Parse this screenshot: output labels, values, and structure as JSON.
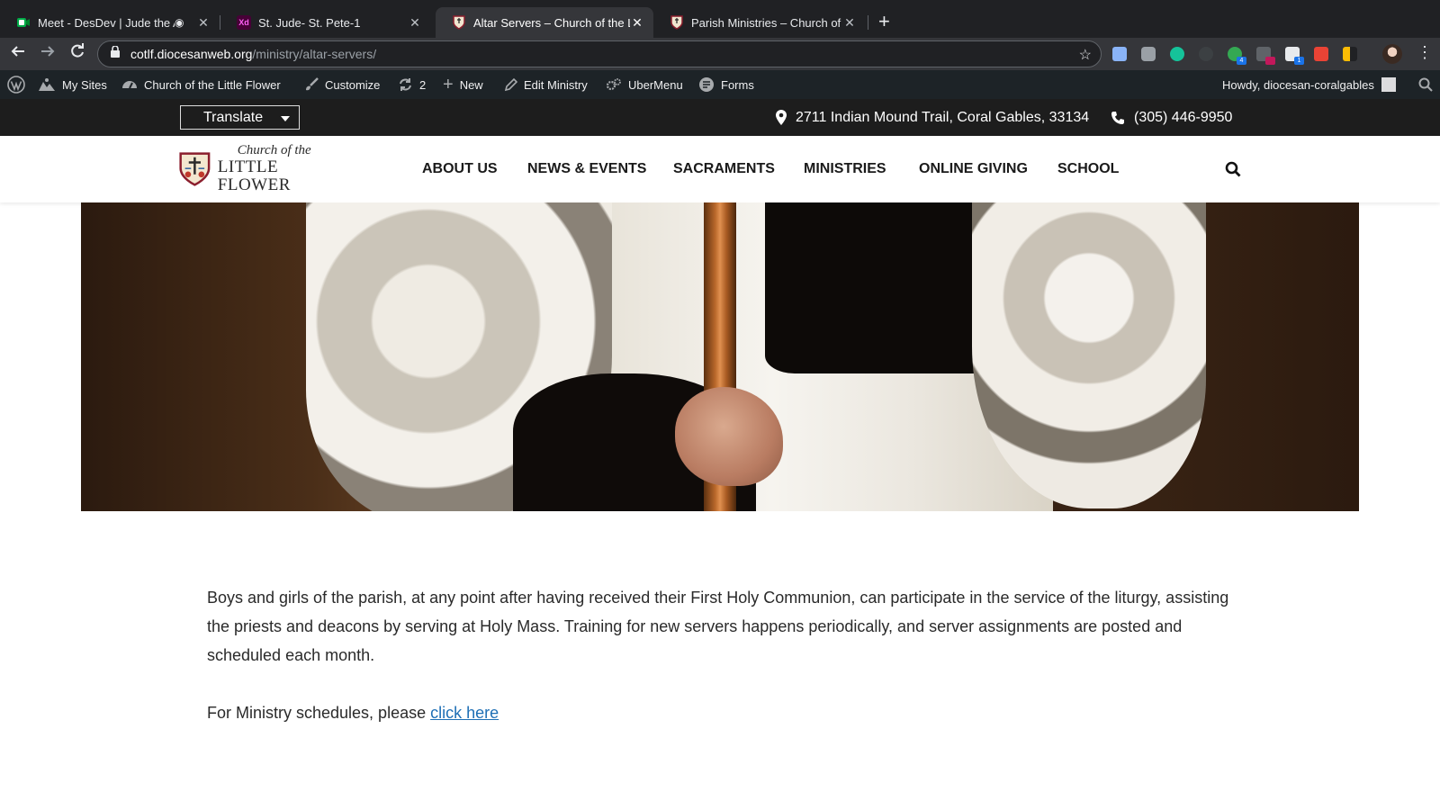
{
  "browser": {
    "tabs": [
      {
        "title": "Meet - DesDev | Jude the A",
        "active": false
      },
      {
        "title": "St. Jude- St. Pete-1",
        "active": false,
        "favicon_text": "Xd"
      },
      {
        "title": "Altar Servers – Church of the L",
        "active": true
      },
      {
        "title": "Parish Ministries – Church of th",
        "active": false
      }
    ],
    "url_domain": "cotlf.diocesanweb.org",
    "url_path": "/ministry/altar-servers/"
  },
  "admin_bar": {
    "my_sites": "My Sites",
    "site_name": "Church of the Little Flower",
    "customize": "Customize",
    "updates_count": "2",
    "new": "New",
    "edit": "Edit Ministry",
    "ubermenu": "UberMenu",
    "forms": "Forms",
    "howdy": "Howdy, diocesan-coralgables"
  },
  "topbar": {
    "translate_label": "Translate",
    "address": "2711 Indian Mound Trail, Coral Gables, 33134",
    "phone": "(305) 446-9950"
  },
  "header": {
    "logo_line1": "Church of the",
    "logo_line2": "LITTLE FLOWER",
    "nav": [
      "ABOUT US",
      "NEWS & EVENTS",
      "SACRAMENTS",
      "MINISTRIES",
      "ONLINE GIVING",
      "SCHOOL"
    ]
  },
  "content": {
    "paragraph": "Boys and girls of the parish, at any point after having received their First Holy Communion, can participate in the service of the liturgy, assisting the priests and deacons by serving at Holy Mass. Training for new servers happens periodically, and server assignments are posted and scheduled each month.",
    "schedule_prefix": "For Ministry schedules, please ",
    "schedule_link": "click here"
  },
  "colors": {
    "admin_bar_bg": "#1d2327",
    "topbar_bg": "#1d1d1d",
    "link": "#1e6fb5"
  }
}
